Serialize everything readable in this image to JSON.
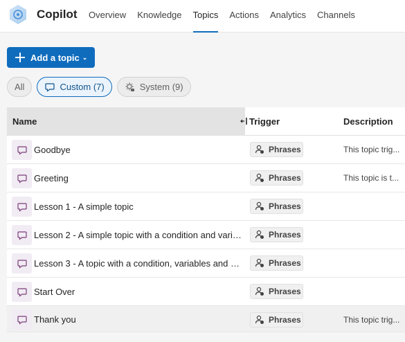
{
  "app": {
    "title": "Copilot"
  },
  "nav": [
    {
      "label": "Overview",
      "active": false
    },
    {
      "label": "Knowledge",
      "active": false
    },
    {
      "label": "Topics",
      "active": true
    },
    {
      "label": "Actions",
      "active": false
    },
    {
      "label": "Analytics",
      "active": false
    },
    {
      "label": "Channels",
      "active": false
    }
  ],
  "toolbar": {
    "add_label": "Add a topic",
    "add_chevron": "⌄"
  },
  "filters": {
    "all": "All",
    "custom": "Custom (7)",
    "system": "System (9)",
    "active": "custom"
  },
  "table": {
    "headers": {
      "name": "Name",
      "trigger": "Trigger",
      "description": "Description"
    },
    "rows": [
      {
        "name": "Goodbye",
        "trigger": "Phrases",
        "description": "This topic trig..."
      },
      {
        "name": "Greeting",
        "trigger": "Phrases",
        "description": "This topic is t..."
      },
      {
        "name": "Lesson 1 - A simple topic",
        "trigger": "Phrases",
        "description": ""
      },
      {
        "name": "Lesson 2 - A simple topic with a condition and varia...",
        "trigger": "Phrases",
        "description": ""
      },
      {
        "name": "Lesson 3 - A topic with a condition, variables and a ...",
        "trigger": "Phrases",
        "description": ""
      },
      {
        "name": "Start Over",
        "trigger": "Phrases",
        "description": ""
      },
      {
        "name": "Thank you",
        "trigger": "Phrases",
        "description": "This topic trig..."
      }
    ]
  },
  "colors": {
    "accent": "#0f6cbd",
    "topic_icon": "#7a3e7a",
    "topic_icon_bg": "#f1ebf3"
  }
}
